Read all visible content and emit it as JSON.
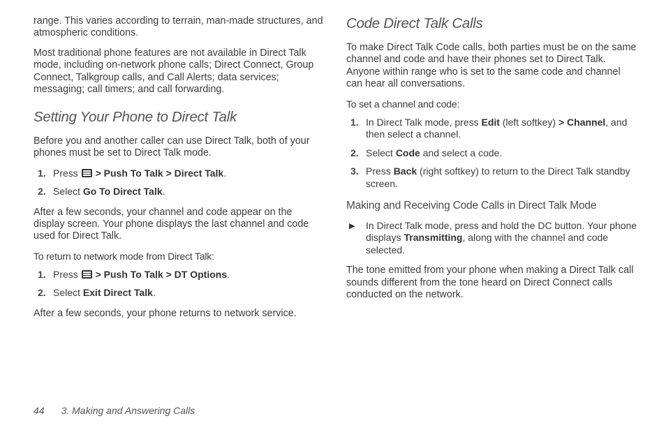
{
  "left": {
    "p1": "range. This varies according to terrain, man-made structures, and atmospheric conditions.",
    "p2": "Most traditional phone features are not available in Direct Talk mode, including on-network phone calls; Direct Connect, Group Connect, Talkgroup calls, and Call Alerts; data services; messaging; call timers; and call forwarding.",
    "h2": "Setting Your Phone to Direct Talk",
    "p3": "Before you and another caller can use Direct Talk, both of your phones must be set to Direct Talk mode.",
    "ol1": {
      "i1_a": "Press ",
      "i1_b": " > ",
      "i1_c": "Push To Talk",
      "i1_d": " > ",
      "i1_e": "Direct Talk",
      "i1_f": ".",
      "i2_a": "Select ",
      "i2_b": "Go To Direct Talk",
      "i2_c": "."
    },
    "p4": "After a few seconds, your channel and code appear on the display screen. Your phone displays the last channel and code used for Direct Talk.",
    "intro2": "To return to network mode from Direct Talk:",
    "ol2": {
      "i1_a": "Press ",
      "i1_b": " > ",
      "i1_c": "Push To Talk",
      "i1_d": " > ",
      "i1_e": "DT Options",
      "i1_f": ".",
      "i2_a": "Select ",
      "i2_b": "Exit Direct Talk",
      "i2_c": "."
    },
    "p5": "After a few seconds, your phone returns to network service."
  },
  "right": {
    "h2": "Code Direct Talk Calls",
    "p1": "To make Direct Talk Code calls, both parties must be on the same channel and code and have their phones set to Direct Talk. Anyone within range who is set to the same code and channel can hear all conversations.",
    "intro1": "To set a channel and code:",
    "ol1": {
      "i1_a": "In Direct Talk mode, press ",
      "i1_b": "Edit",
      "i1_c": " (left softkey) ",
      "i1_d": "> ",
      "i1_e": "Channel",
      "i1_f": ", and then select a channel.",
      "i2_a": "Select ",
      "i2_b": "Code",
      "i2_c": " and select a code.",
      "i3_a": "Press ",
      "i3_b": "Back",
      "i3_c": " (right softkey) to return to the Direct Talk standby screen."
    },
    "h3": "Making and Receiving Code Calls in Direct Talk Mode",
    "b1_a": "In Direct Talk mode, press and hold the DC button. Your phone displays ",
    "b1_b": "Transmitting",
    "b1_c": ", along with the channel and code selected.",
    "p2": "The tone emitted from your phone when making a Direct Talk call sounds different from the tone heard on Direct Connect calls conducted on the network."
  },
  "footer": {
    "page": "44",
    "chapter": "3. Making and Answering Calls"
  }
}
